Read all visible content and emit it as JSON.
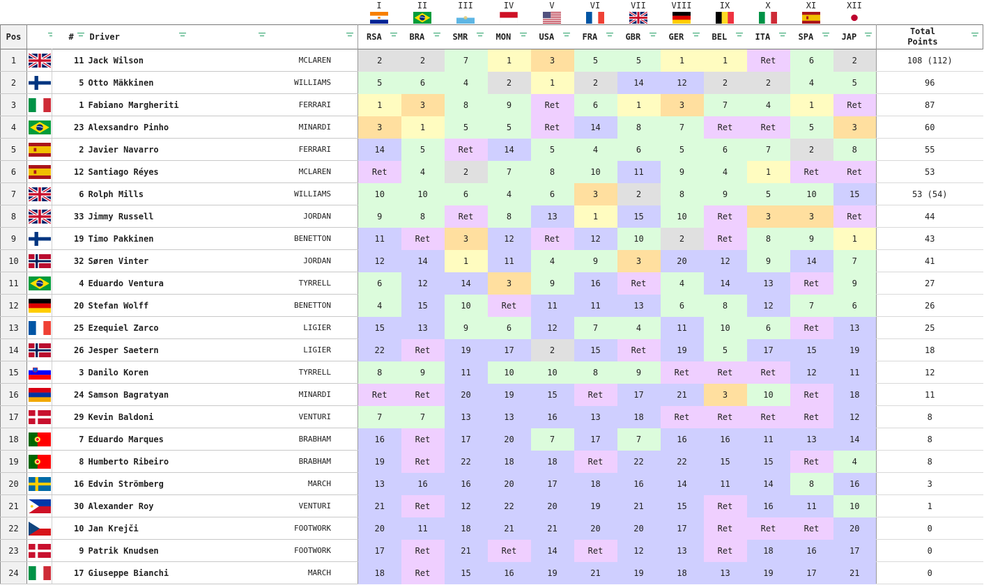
{
  "rounds": [
    {
      "numeral": "I",
      "flag": "rsa",
      "abbr": "RSA"
    },
    {
      "numeral": "II",
      "flag": "bra",
      "abbr": "BRA"
    },
    {
      "numeral": "III",
      "flag": "smr",
      "abbr": "SMR"
    },
    {
      "numeral": "IV",
      "flag": "mon",
      "abbr": "MON"
    },
    {
      "numeral": "V",
      "flag": "usa",
      "abbr": "USA"
    },
    {
      "numeral": "VI",
      "flag": "fra",
      "abbr": "FRA"
    },
    {
      "numeral": "VII",
      "flag": "gbr",
      "abbr": "GBR"
    },
    {
      "numeral": "VIII",
      "flag": "ger",
      "abbr": "GER"
    },
    {
      "numeral": "IX",
      "flag": "bel",
      "abbr": "BEL"
    },
    {
      "numeral": "X",
      "flag": "ita",
      "abbr": "ITA"
    },
    {
      "numeral": "XI",
      "flag": "spa",
      "abbr": "SPA"
    },
    {
      "numeral": "XII",
      "flag": "jap",
      "abbr": "JAP"
    }
  ],
  "headers": {
    "pos": "Pos",
    "num": "#",
    "driver": "Driver",
    "total": "Total Points"
  },
  "colors": {
    "gold": "#fffcc0",
    "silver": "#e0e0e0",
    "bronze": "#ffdf9f",
    "points": "#dcfcdc",
    "finish": "#cfcfff",
    "ret": "#efcfff",
    "white": "#ffffff"
  },
  "rows": [
    {
      "pos": "1",
      "flag": "gbr",
      "num": "11",
      "driver": "Jack Wilson",
      "team": "MCLAREN",
      "results": [
        "2",
        "2",
        "7",
        "1",
        "3",
        "5",
        "5",
        "1",
        "1",
        "Ret",
        "6",
        "2"
      ],
      "points": "108 (112)"
    },
    {
      "pos": "2",
      "flag": "fin",
      "num": "5",
      "driver": "Otto Mäkkinen",
      "team": "WILLIAMS",
      "results": [
        "5",
        "6",
        "4",
        "2",
        "1",
        "2",
        "14",
        "12",
        "2",
        "2",
        "4",
        "5"
      ],
      "points": "96"
    },
    {
      "pos": "3",
      "flag": "ita",
      "num": "1",
      "driver": "Fabiano Margheriti",
      "team": "FERRARI",
      "results": [
        "1",
        "3",
        "8",
        "9",
        "Ret",
        "6",
        "1",
        "3",
        "7",
        "4",
        "1",
        "Ret"
      ],
      "points": "87"
    },
    {
      "pos": "4",
      "flag": "bra",
      "num": "23",
      "driver": "Alexsandro Pinho",
      "team": "MINARDI",
      "results": [
        "3",
        "1",
        "5",
        "5",
        "Ret",
        "14",
        "8",
        "7",
        "Ret",
        "Ret",
        "5",
        "3"
      ],
      "points": "60"
    },
    {
      "pos": "5",
      "flag": "spa",
      "num": "2",
      "driver": "Javier Navarro",
      "team": "FERRARI",
      "results": [
        "14",
        "5",
        "Ret",
        "14",
        "5",
        "4",
        "6",
        "5",
        "6",
        "7",
        "2",
        "8"
      ],
      "points": "55"
    },
    {
      "pos": "6",
      "flag": "spa",
      "num": "12",
      "driver": "Santiago Réyes",
      "team": "MCLAREN",
      "results": [
        "Ret",
        "4",
        "2",
        "7",
        "8",
        "10",
        "11",
        "9",
        "4",
        "1",
        "Ret",
        "Ret"
      ],
      "points": "53"
    },
    {
      "pos": "7",
      "flag": "gbr",
      "num": "6",
      "driver": "Rolph Mills",
      "team": "WILLIAMS",
      "results": [
        "10",
        "10",
        "6",
        "4",
        "6",
        "3",
        "2",
        "8",
        "9",
        "5",
        "10",
        "15"
      ],
      "points": "53 (54)"
    },
    {
      "pos": "8",
      "flag": "gbr",
      "num": "33",
      "driver": "Jimmy Russell",
      "team": "JORDAN",
      "results": [
        "9",
        "8",
        "Ret",
        "8",
        "13",
        "1",
        "15",
        "10",
        "Ret",
        "3",
        "3",
        "Ret"
      ],
      "points": "44"
    },
    {
      "pos": "9",
      "flag": "fin",
      "num": "19",
      "driver": "Timo Pakkinen",
      "team": "BENETTON",
      "results": [
        "11",
        "Ret",
        "3",
        "12",
        "Ret",
        "12",
        "10",
        "2",
        "Ret",
        "8",
        "9",
        "1"
      ],
      "points": "43"
    },
    {
      "pos": "10",
      "flag": "nor",
      "num": "32",
      "driver": "Søren Vinter",
      "team": "JORDAN",
      "results": [
        "12",
        "14",
        "1",
        "11",
        "4",
        "9",
        "3",
        "20",
        "12",
        "9",
        "14",
        "7"
      ],
      "points": "41"
    },
    {
      "pos": "11",
      "flag": "bra",
      "num": "4",
      "driver": "Eduardo Ventura",
      "team": "TYRRELL",
      "results": [
        "6",
        "12",
        "14",
        "3",
        "9",
        "16",
        "Ret",
        "4",
        "14",
        "13",
        "Ret",
        "9"
      ],
      "points": "27"
    },
    {
      "pos": "12",
      "flag": "ger",
      "num": "20",
      "driver": "Stefan Wolff",
      "team": "BENETTON",
      "results": [
        "4",
        "15",
        "10",
        "Ret",
        "11",
        "11",
        "13",
        "6",
        "8",
        "12",
        "7",
        "6"
      ],
      "points": "26"
    },
    {
      "pos": "13",
      "flag": "fra",
      "num": "25",
      "driver": "Ezequiel Zarco",
      "team": "LIGIER",
      "results": [
        "15",
        "13",
        "9",
        "6",
        "12",
        "7",
        "4",
        "11",
        "10",
        "6",
        "Ret",
        "13"
      ],
      "points": "25"
    },
    {
      "pos": "14",
      "flag": "nor",
      "num": "26",
      "driver": "Jesper Saetern",
      "team": "LIGIER",
      "results": [
        "22",
        "Ret",
        "19",
        "17",
        "2",
        "15",
        "Ret",
        "19",
        "5",
        "17",
        "15",
        "19"
      ],
      "points": "18"
    },
    {
      "pos": "15",
      "flag": "slo",
      "num": "3",
      "driver": "Danilo Koren",
      "team": "TYRRELL",
      "results": [
        "8",
        "9",
        "11",
        "10",
        "10",
        "8",
        "9",
        "Ret",
        "Ret",
        "Ret",
        "12",
        "11"
      ],
      "points": "12"
    },
    {
      "pos": "16",
      "flag": "arm",
      "num": "24",
      "driver": "Samson Bagratyan",
      "team": "MINARDI",
      "results": [
        "Ret",
        "Ret",
        "20",
        "19",
        "15",
        "Ret",
        "17",
        "21",
        "3",
        "10",
        "Ret",
        "18"
      ],
      "points": "11"
    },
    {
      "pos": "17",
      "flag": "den",
      "num": "29",
      "driver": "Kevin Baldoni",
      "team": "VENTURI",
      "results": [
        "7",
        "7",
        "13",
        "13",
        "16",
        "13",
        "18",
        "Ret",
        "Ret",
        "Ret",
        "Ret",
        "12"
      ],
      "points": "8"
    },
    {
      "pos": "18",
      "flag": "por",
      "num": "7",
      "driver": "Eduardo Marques",
      "team": "BRABHAM",
      "results": [
        "16",
        "Ret",
        "17",
        "20",
        "7",
        "17",
        "7",
        "16",
        "16",
        "11",
        "13",
        "14"
      ],
      "points": "8"
    },
    {
      "pos": "19",
      "flag": "por",
      "num": "8",
      "driver": "Humberto Ribeiro",
      "team": "BRABHAM",
      "results": [
        "19",
        "Ret",
        "22",
        "18",
        "18",
        "Ret",
        "22",
        "22",
        "15",
        "15",
        "Ret",
        "4"
      ],
      "points": "8"
    },
    {
      "pos": "20",
      "flag": "swe",
      "num": "16",
      "driver": "Edvin Strömberg",
      "team": "MARCH",
      "results": [
        "13",
        "16",
        "16",
        "20",
        "17",
        "18",
        "16",
        "14",
        "11",
        "14",
        "8",
        "16"
      ],
      "points": "3"
    },
    {
      "pos": "21",
      "flag": "phi",
      "num": "30",
      "driver": "Alexander Roy",
      "team": "VENTURI",
      "results": [
        "21",
        "Ret",
        "12",
        "22",
        "20",
        "19",
        "21",
        "15",
        "Ret",
        "16",
        "11",
        "10"
      ],
      "points": "1"
    },
    {
      "pos": "22",
      "flag": "cze",
      "num": "10",
      "driver": "Jan Krejči",
      "team": "FOOTWORK",
      "results": [
        "20",
        "11",
        "18",
        "21",
        "21",
        "20",
        "20",
        "17",
        "Ret",
        "Ret",
        "Ret",
        "20"
      ],
      "points": "0"
    },
    {
      "pos": "23",
      "flag": "den",
      "num": "9",
      "driver": "Patrik Knudsen",
      "team": "FOOTWORK",
      "results": [
        "17",
        "Ret",
        "21",
        "Ret",
        "14",
        "Ret",
        "12",
        "13",
        "Ret",
        "18",
        "16",
        "17"
      ],
      "points": "0"
    },
    {
      "pos": "24",
      "flag": "ita",
      "num": "17",
      "driver": "Giuseppe Bianchi",
      "team": "MARCH",
      "results": [
        "18",
        "Ret",
        "15",
        "16",
        "19",
        "21",
        "19",
        "18",
        "13",
        "19",
        "17",
        "21"
      ],
      "points": "0"
    }
  ]
}
